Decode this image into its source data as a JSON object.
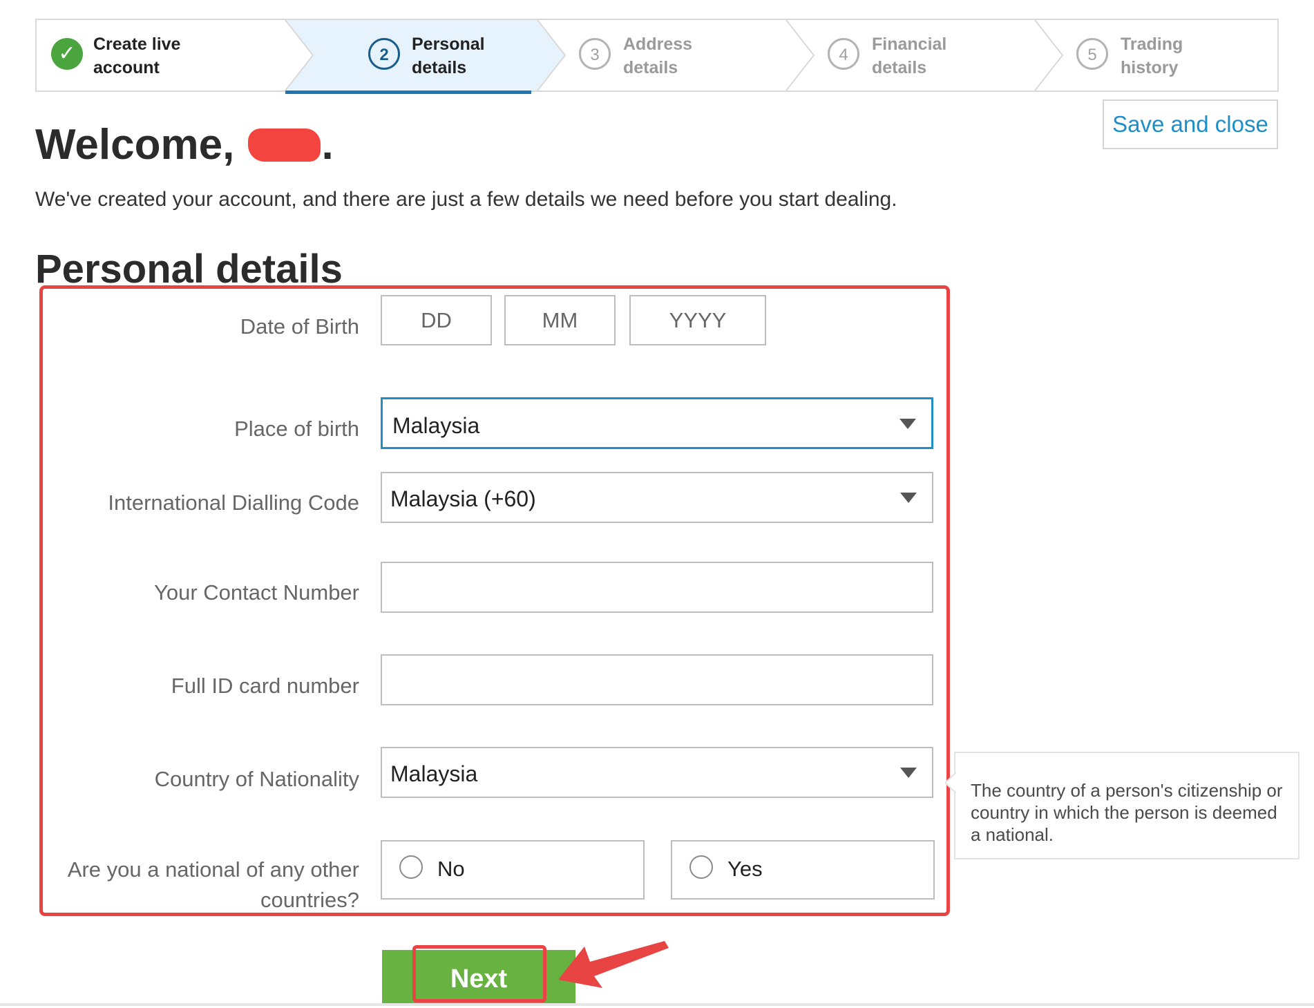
{
  "stepper": {
    "steps": [
      {
        "number": "",
        "label_line1": "Create live",
        "label_line2": "account",
        "state": "done"
      },
      {
        "number": "2",
        "label_line1": "Personal",
        "label_line2": "details",
        "state": "active"
      },
      {
        "number": "3",
        "label_line1": "Address",
        "label_line2": "details",
        "state": "todo"
      },
      {
        "number": "4",
        "label_line1": "Financial",
        "label_line2": "details",
        "state": "todo"
      },
      {
        "number": "5",
        "label_line1": "Trading",
        "label_line2": "history",
        "state": "todo"
      }
    ]
  },
  "header": {
    "save_close_label": "Save and close",
    "welcome_prefix": "Welcome,",
    "welcome_suffix": ".",
    "intro": "We've created your account, and there are just a few details we need before you start dealing."
  },
  "form": {
    "title": "Personal details",
    "dob": {
      "label": "Date of Birth",
      "day_placeholder": "DD",
      "month_placeholder": "MM",
      "year_placeholder": "YYYY"
    },
    "place_of_birth": {
      "label": "Place of birth",
      "value": "Malaysia"
    },
    "dialling_code": {
      "label": "International Dialling Code",
      "value": "Malaysia (+60)"
    },
    "contact_number": {
      "label": "Your Contact Number",
      "value": ""
    },
    "id_card": {
      "label": "Full ID card number",
      "value": ""
    },
    "nationality": {
      "label": "Country of Nationality",
      "value": "Malaysia"
    },
    "other_national": {
      "label_line1": "Are you a national of any other",
      "label_line2": "countries?",
      "option_no": "No",
      "option_yes": "Yes"
    },
    "next_label": "Next"
  },
  "tooltip": {
    "text": "The country of a person's citizenship or country in which the person is deemed a national."
  },
  "colors": {
    "accent_blue": "#1f75b4",
    "success_green": "#4aa53f",
    "next_green": "#67b240",
    "annotation_red": "#e84444",
    "link_blue": "#1d8ec8"
  }
}
